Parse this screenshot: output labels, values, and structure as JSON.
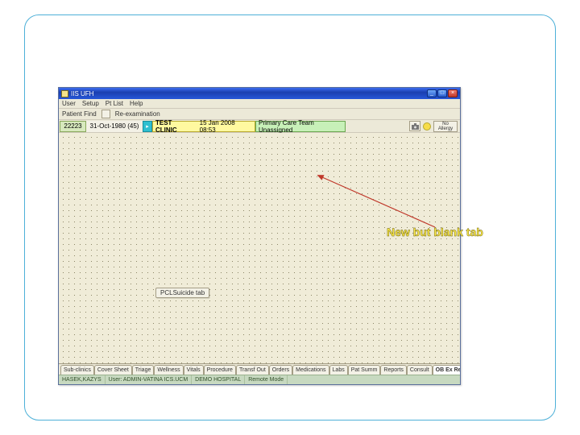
{
  "window": {
    "title": "IIS UFH",
    "controls": {
      "min": "_",
      "max": "□",
      "close": "×"
    }
  },
  "menubar": [
    "User",
    "Setup",
    "Pt List",
    "Help"
  ],
  "toolbar": {
    "patient_label": "Patient Find",
    "reexam_label": "Re-examination"
  },
  "patient": {
    "id": "22223",
    "dob": "31-Oct-1980 (45)"
  },
  "clinic": {
    "name": "TEST CLINIC",
    "datetime": "15 Jan 2008 08:53"
  },
  "pct_box": "Primary Care Team Unassigned",
  "right_tools": {
    "allergy_line1": "No",
    "allergy_line2": "Allergy"
  },
  "inside_tab_label": "PCLSuicide tab",
  "tabs": [
    "Sub-clinics",
    "Cover Sheet",
    "Triage",
    "Wellness",
    "Vitals",
    "Procedure",
    "Transf Out",
    "Orders",
    "Medications",
    "Labs",
    "Pat Summ",
    "Reports",
    "Consult",
    "OB Ex Record"
  ],
  "active_tab_index": 13,
  "statusbar": {
    "cells": [
      "HASEK,KAZYS",
      "User: ADMIN-VATINA ICS.UCM",
      "DEMO HOSPITAL",
      "Remote Mode"
    ]
  },
  "annotation": "New but blank tab"
}
